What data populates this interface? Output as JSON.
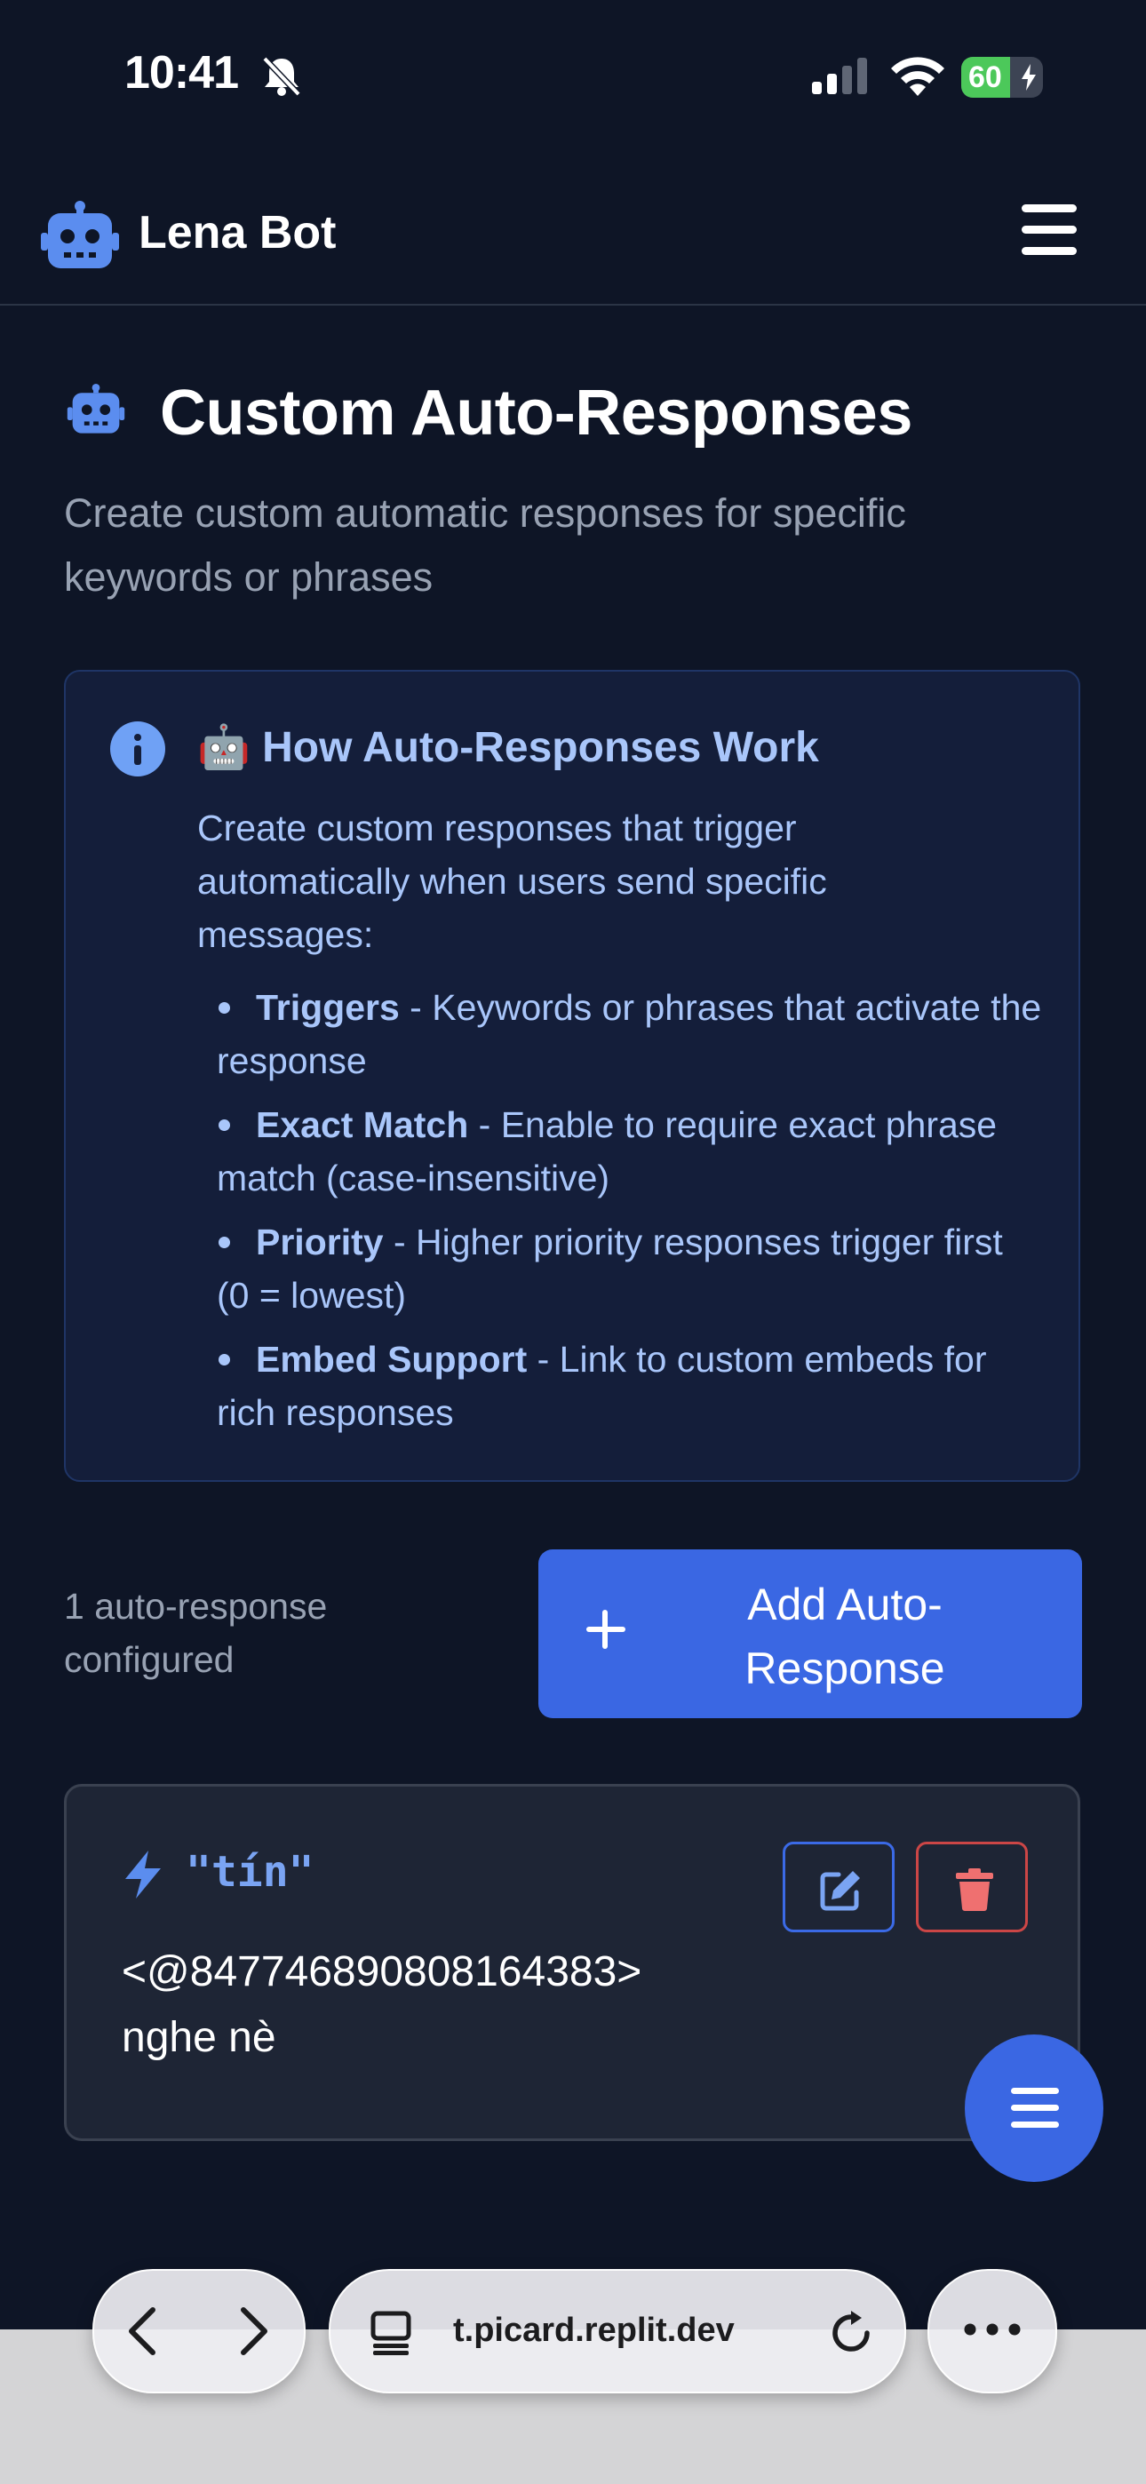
{
  "status_bar": {
    "time": "10:41",
    "battery_percent": "60",
    "battery_level": 0.6,
    "icons": [
      "bell-slash-icon",
      "signal-icon",
      "wifi-icon",
      "battery-charging-icon"
    ]
  },
  "navbar": {
    "brand_name": "Lena Bot",
    "brand_icon": "robot-icon",
    "menu_icon": "hamburger-icon"
  },
  "page": {
    "title": "Custom Auto-Responses",
    "subtitle": "Create custom automatic responses for specific keywords or phrases"
  },
  "info_box": {
    "title": "🤖 How Auto-Responses Work",
    "description": "Create custom responses that trigger automatically when users send specific messages:",
    "items": [
      {
        "term": "Triggers",
        "text": " - Keywords or phrases that activate the response"
      },
      {
        "term": "Exact Match",
        "text": " - Enable to require exact phrase match (case-insensitive)"
      },
      {
        "term": "Priority",
        "text": " - Higher priority responses trigger first (0 = lowest)"
      },
      {
        "term": "Embed Support",
        "text": " - Link to custom embeds for rich responses"
      }
    ]
  },
  "toolbar": {
    "count_text": "1 auto-response configured",
    "add_button_label": "Add Auto-Response"
  },
  "responses": [
    {
      "trigger": "\"tín\"",
      "response_line1": "<@847746890808164383>",
      "response_line2": "nghe nè"
    }
  ],
  "browser": {
    "url": "t.picard.replit.dev"
  },
  "colors": {
    "background": "#0e1526",
    "accent": "#3a67e3",
    "info_text": "#a9c6fa",
    "danger": "#cc4646"
  }
}
